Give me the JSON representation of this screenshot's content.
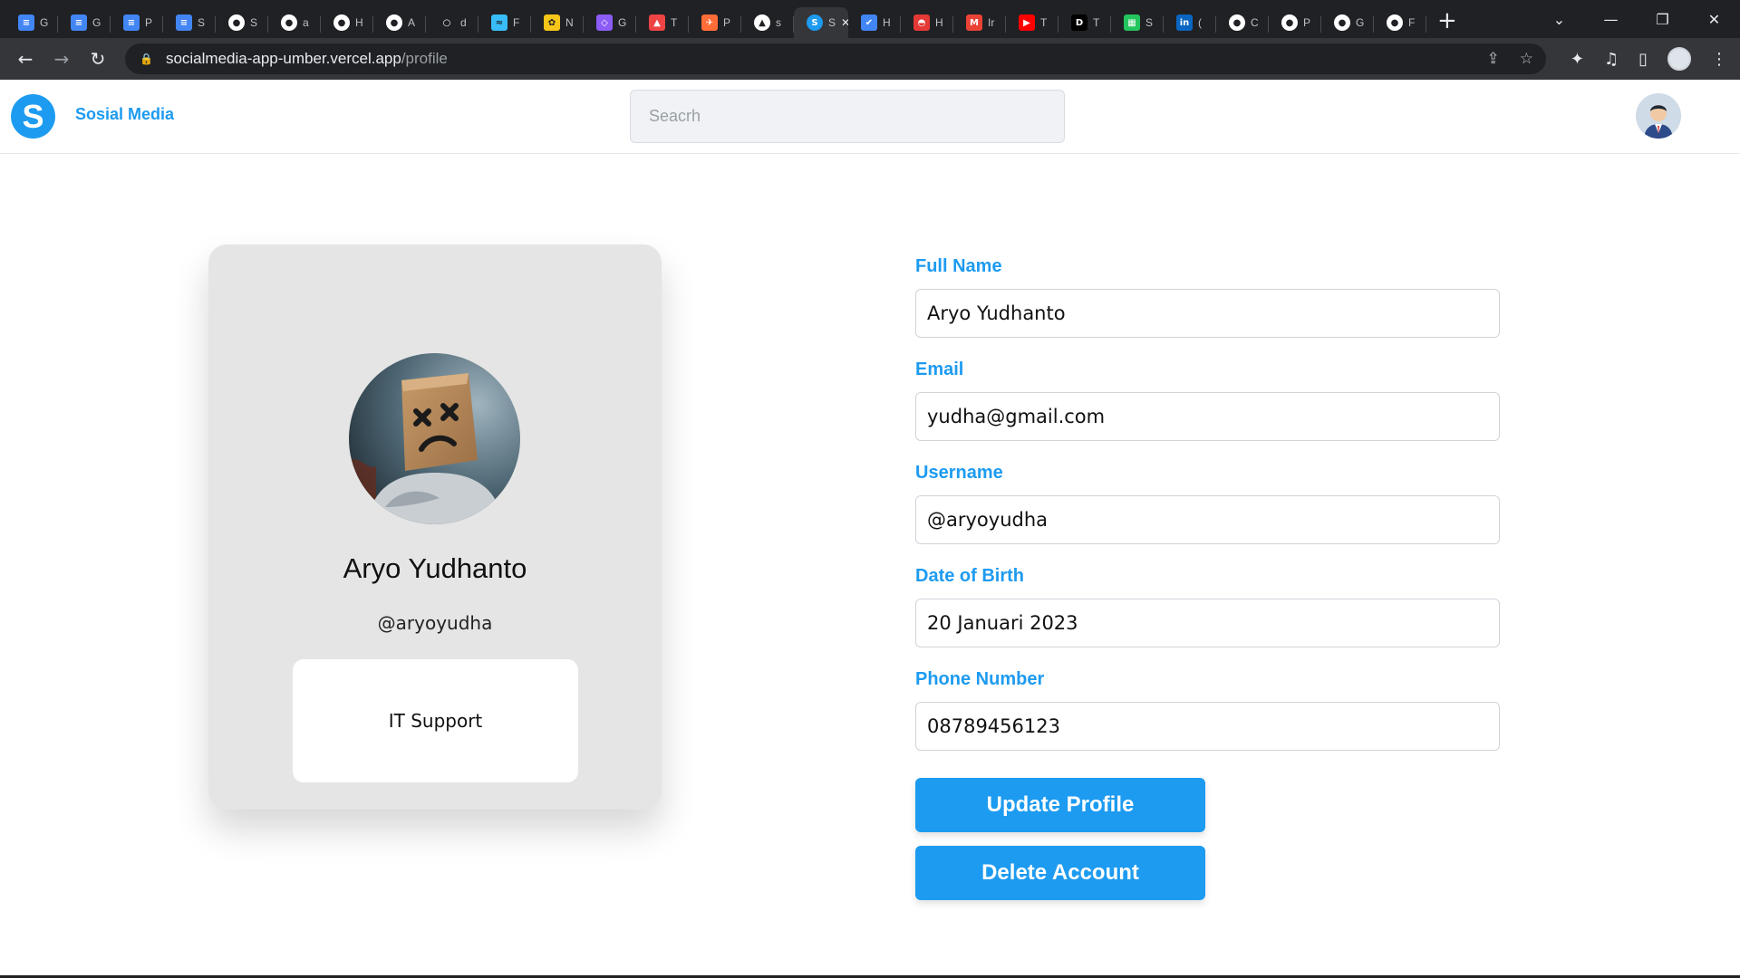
{
  "browser": {
    "tabs": [
      {
        "letter": "G",
        "icon": "google-docs-icon",
        "color": "#4285f4"
      },
      {
        "letter": "G",
        "icon": "google-docs-icon",
        "color": "#4285f4"
      },
      {
        "letter": "P",
        "icon": "google-docs-icon",
        "color": "#4285f4"
      },
      {
        "letter": "S",
        "icon": "google-docs-icon",
        "color": "#4285f4"
      },
      {
        "letter": "S",
        "icon": "github-icon",
        "color": "#ffffff"
      },
      {
        "letter": "a",
        "icon": "github-icon",
        "color": "#ffffff"
      },
      {
        "letter": "H",
        "icon": "github-icon",
        "color": "#ffffff"
      },
      {
        "letter": "A",
        "icon": "github-icon",
        "color": "#ffffff"
      },
      {
        "letter": "d",
        "icon": "circle-icon",
        "color": "#202124"
      },
      {
        "letter": "F",
        "icon": "tailwind-icon",
        "color": "#38bdf8"
      },
      {
        "letter": "N",
        "icon": "flower-icon",
        "color": "#f5c518"
      },
      {
        "letter": "G",
        "icon": "graphql-icon",
        "color": "#8b5cf6"
      },
      {
        "letter": "T",
        "icon": "chart-icon",
        "color": "#ef4444"
      },
      {
        "letter": "P",
        "icon": "postman-icon",
        "color": "#ff6c37"
      },
      {
        "letter": "s",
        "icon": "vercel-icon",
        "color": "#ffffff"
      },
      {
        "letter": "S",
        "icon": "sosial-media-icon",
        "color": "#1d9bf0",
        "active": true
      },
      {
        "letter": "H",
        "icon": "check-icon",
        "color": "#4285f4"
      },
      {
        "letter": "H",
        "icon": "pokeball-icon",
        "color": "#e53935"
      },
      {
        "letter": "Ir",
        "icon": "gmail-icon",
        "color": "#ea4335"
      },
      {
        "letter": "T",
        "icon": "youtube-icon",
        "color": "#ff0000"
      },
      {
        "letter": "T",
        "icon": "dev-icon",
        "color": "#000000"
      },
      {
        "letter": "S",
        "icon": "sheets-icon",
        "color": "#22c55e"
      },
      {
        "letter": "(",
        "icon": "linkedin-icon",
        "color": "#0a66c2"
      },
      {
        "letter": "C",
        "icon": "github-icon",
        "color": "#ffffff"
      },
      {
        "letter": "P",
        "icon": "github-icon",
        "color": "#ffffff"
      },
      {
        "letter": "G",
        "icon": "github-icon",
        "color": "#ffffff"
      },
      {
        "letter": "F",
        "icon": "github-icon",
        "color": "#ffffff"
      }
    ],
    "url_host": "socialmedia-app-umber.vercel.app",
    "url_path": "/profile"
  },
  "header": {
    "logo_letter": "S",
    "brand": "Sosial Media",
    "search_placeholder": "Seacrh"
  },
  "profile_card": {
    "name": "Aryo Yudhanto",
    "handle": "@aryoyudha",
    "bio": "IT Support"
  },
  "form": {
    "full_name_label": "Full Name",
    "full_name_value": "Aryo Yudhanto",
    "email_label": "Email",
    "email_value": "yudha@gmail.com",
    "username_label": "Username",
    "username_value": "@aryoyudha",
    "dob_label": "Date of Birth",
    "dob_value": "20 Januari 2023",
    "phone_label": "Phone Number",
    "phone_value": "08789456123",
    "update_button": "Update Profile",
    "delete_button": "Delete Account"
  },
  "colors": {
    "accent": "#1d9bf0",
    "card_bg": "#e5e5e5"
  }
}
